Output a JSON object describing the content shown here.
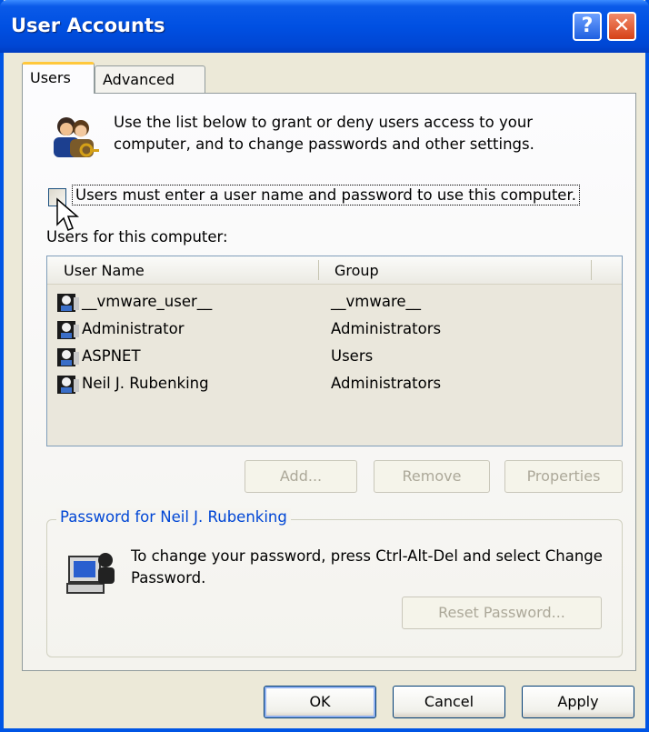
{
  "window": {
    "title": "User Accounts",
    "help_button": "?",
    "close_button": "✕"
  },
  "tabs": [
    {
      "label": "Users",
      "active": true
    },
    {
      "label": "Advanced",
      "active": false
    }
  ],
  "intro_text": "Use the list below to grant or deny users access to your computer, and to change passwords and other settings.",
  "require_password": {
    "label": "Users must enter a user name and password to use this computer.",
    "checked": false
  },
  "users_list": {
    "label": "Users for this computer:",
    "columns": [
      "User Name",
      "Group"
    ],
    "rows": [
      {
        "name": "__vmware_user__",
        "group": "__vmware__"
      },
      {
        "name": "Administrator",
        "group": "Administrators"
      },
      {
        "name": "ASPNET",
        "group": "Users"
      },
      {
        "name": "Neil J. Rubenking",
        "group": "Administrators"
      }
    ]
  },
  "list_buttons": {
    "add": "Add...",
    "remove": "Remove",
    "properties": "Properties"
  },
  "password_group": {
    "title": "Password for Neil J. Rubenking",
    "text": "To change your password, press Ctrl-Alt-Del and select Change Password.",
    "reset_button": "Reset Password..."
  },
  "dialog_buttons": {
    "ok": "OK",
    "cancel": "Cancel",
    "apply": "Apply"
  },
  "colors": {
    "title_bar": "#0055e5",
    "group_title": "#0046d5",
    "tab_highlight": "#ffc83c"
  }
}
